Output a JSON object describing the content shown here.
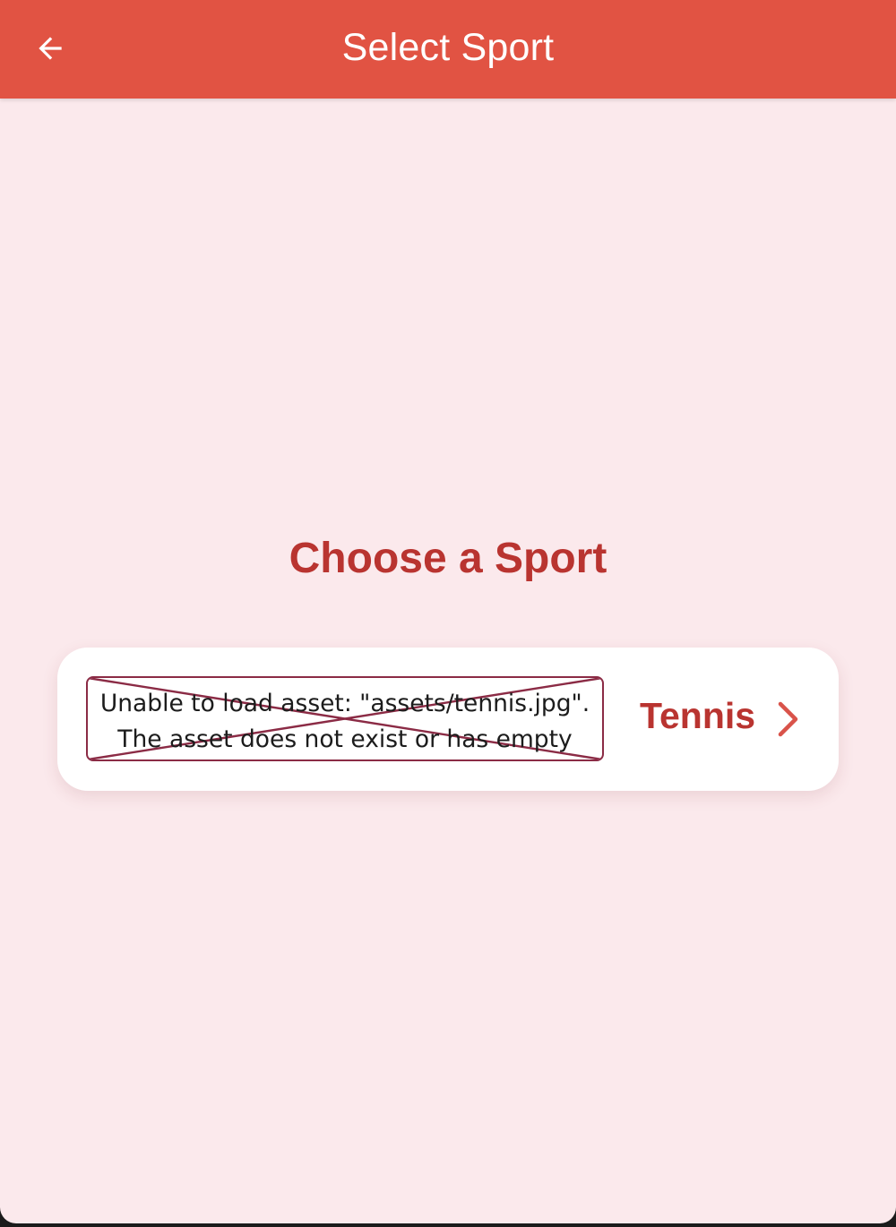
{
  "appbar": {
    "title": "Select Sport",
    "back_icon": "arrow-left-icon",
    "background_color": "#e15343"
  },
  "main": {
    "heading": "Choose a Sport",
    "background_color": "#fbe9ec",
    "sports": [
      {
        "label": "Tennis",
        "image_error": "Unable to load asset: \"assets/tennis.jpg\".\nThe asset does not exist or has empty data.",
        "trailing_icon": "chevron-right-icon"
      }
    ]
  },
  "accent_color": "#b93430"
}
